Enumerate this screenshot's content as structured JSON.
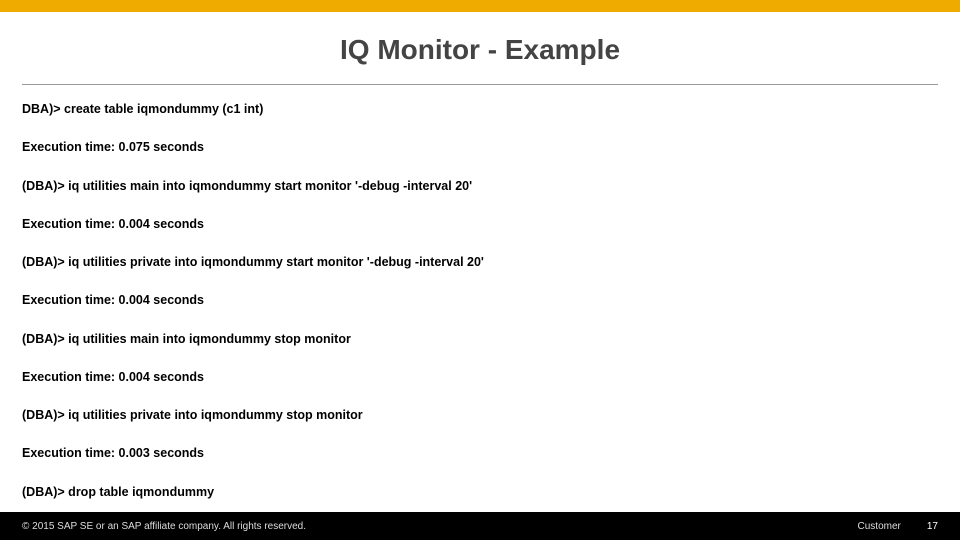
{
  "title": "IQ Monitor - Example",
  "lines": [
    "DBA)> create table iqmondummy (c1 int)",
    "Execution time: 0.075 seconds",
    "(DBA)> iq utilities main into iqmondummy start monitor '-debug -interval 20'",
    "Execution time: 0.004 seconds",
    "(DBA)> iq utilities private into iqmondummy start monitor '-debug -interval 20'",
    "Execution time: 0.004 seconds",
    "(DBA)> iq utilities main  into iqmondummy stop monitor",
    "Execution time: 0.004 seconds",
    "(DBA)> iq utilities private into iqmondummy stop monitor",
    "Execution time: 0.003 seconds",
    "(DBA)> drop table iqmondummy"
  ],
  "footer": {
    "copyright": "© 2015 SAP SE or an SAP affiliate company. All rights reserved.",
    "audience": "Customer",
    "page": "17"
  }
}
